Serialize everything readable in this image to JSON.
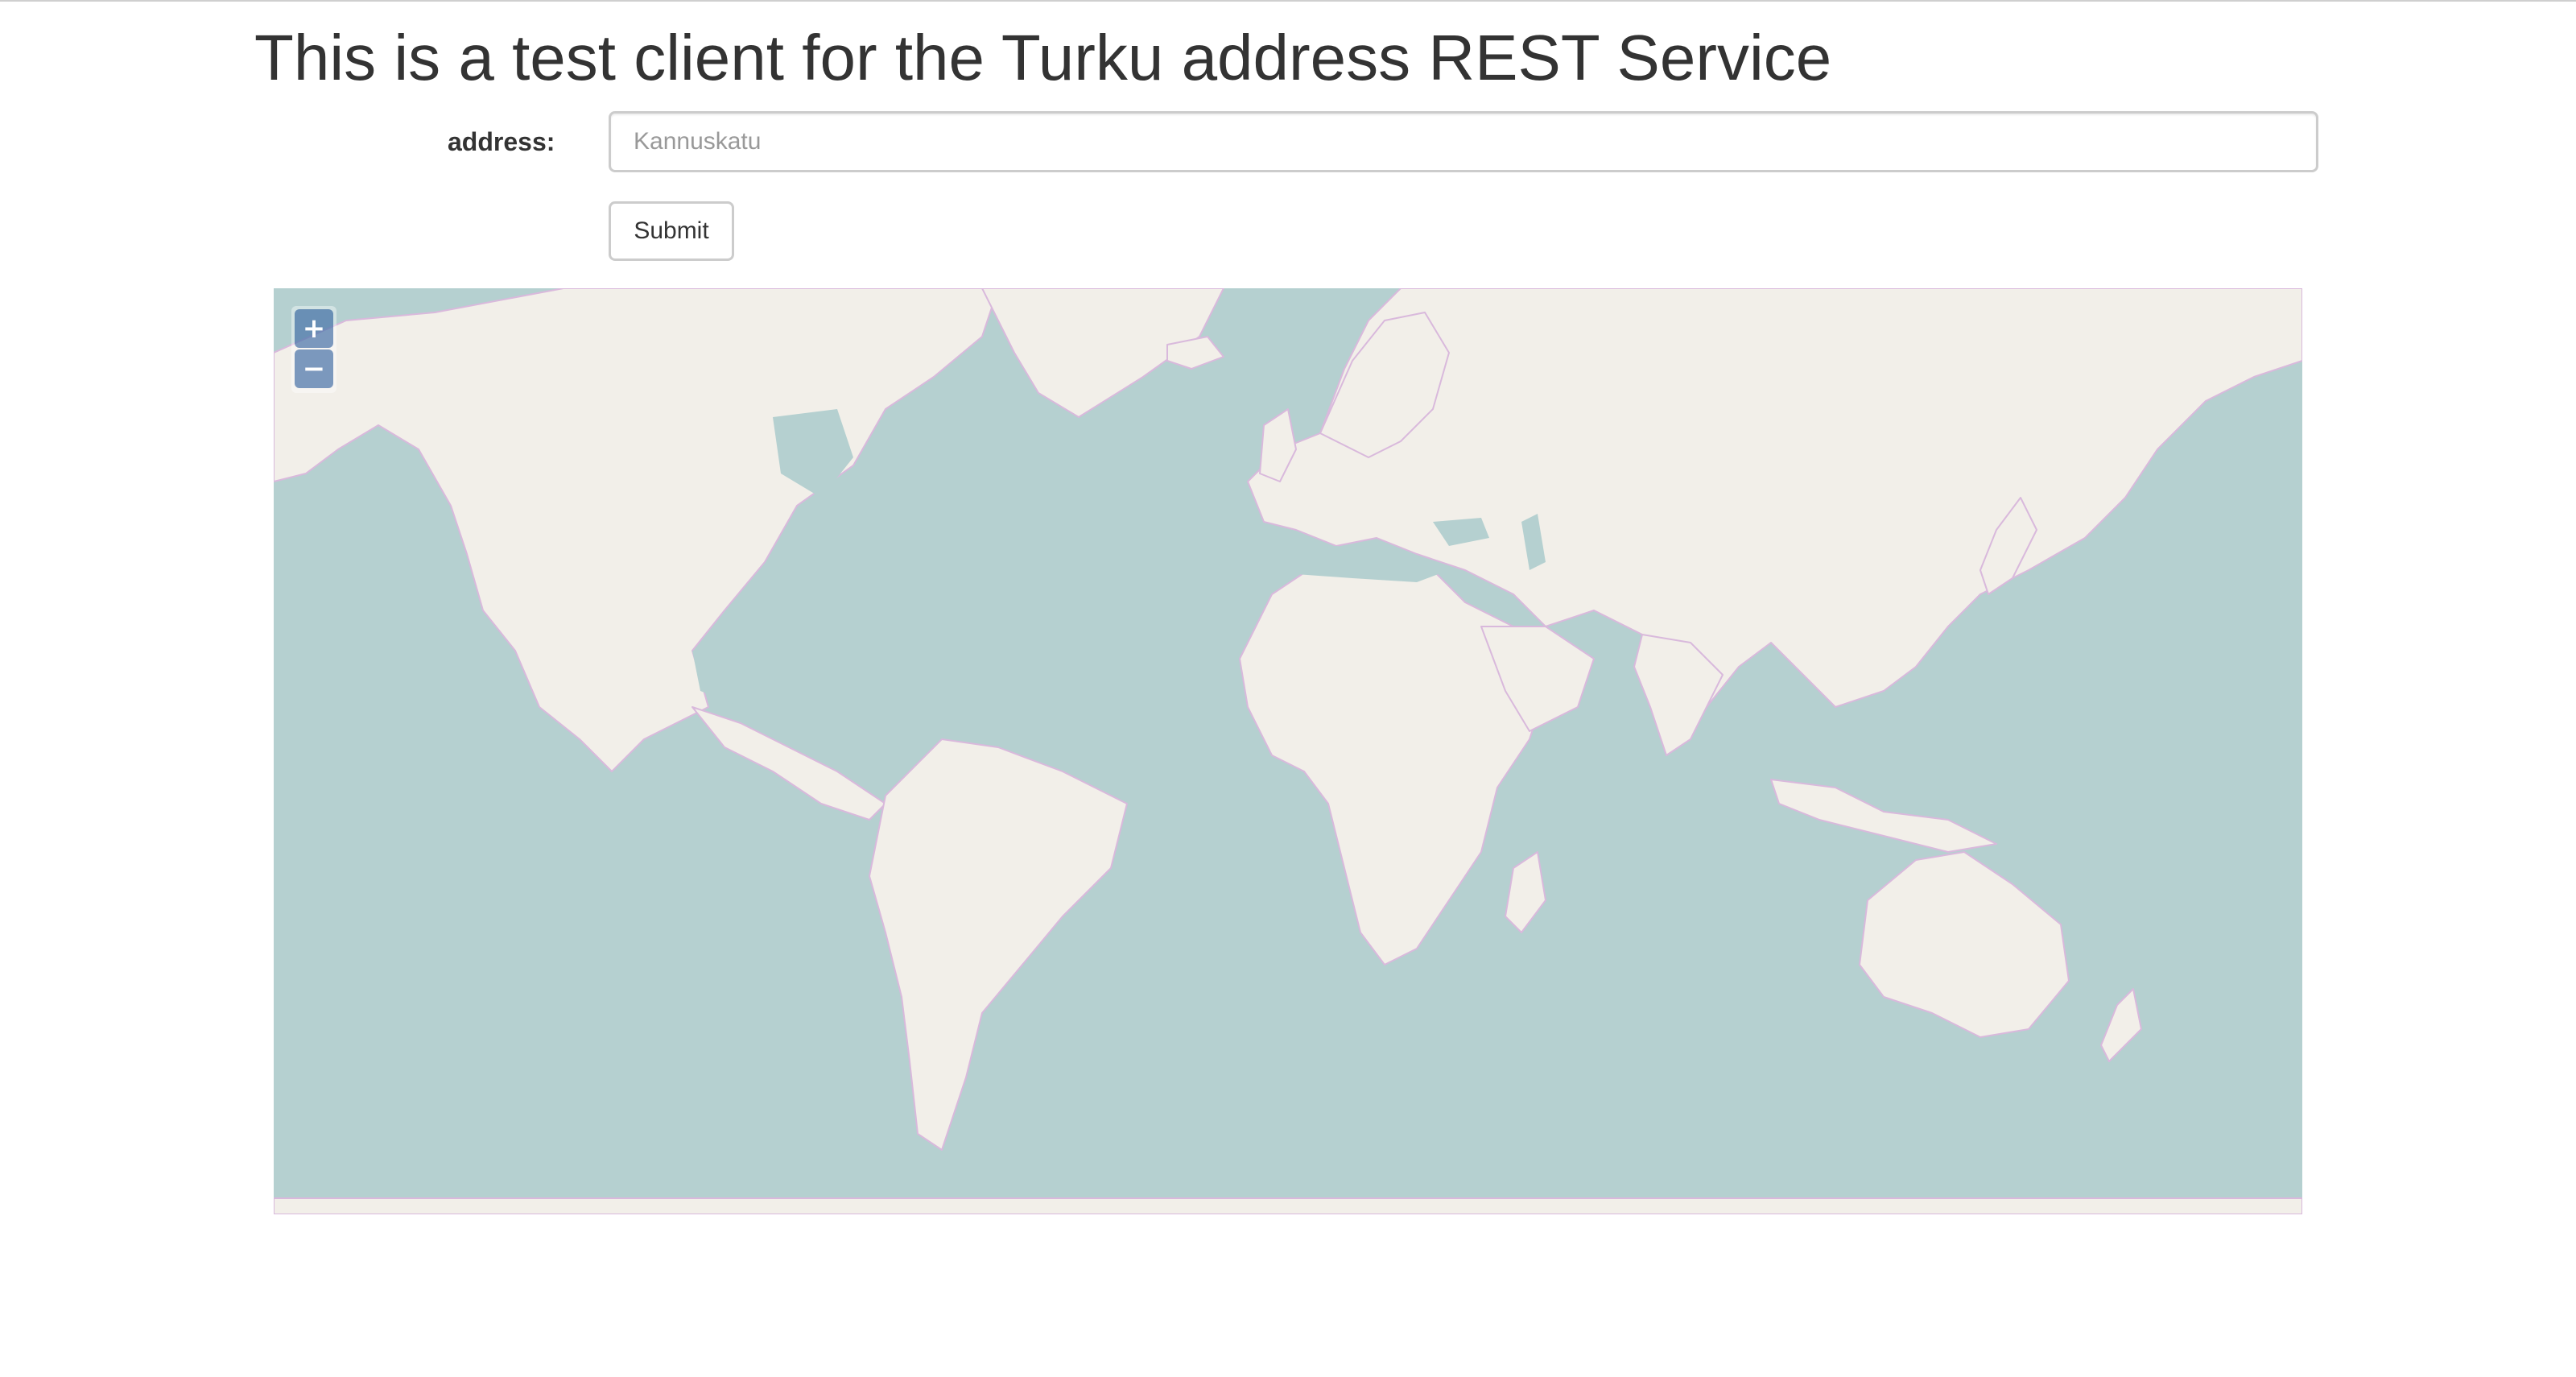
{
  "page": {
    "title": "This is a test client for the Turku address REST Service"
  },
  "form": {
    "address_label": "address:",
    "address_placeholder": "Kannuskatu",
    "address_value": "",
    "submit_label": "Submit"
  },
  "map": {
    "zoom_in_label": "+",
    "zoom_out_label": "−",
    "colors": {
      "water": "#b5d0d0",
      "land": "#f2efe9",
      "border": "#d4a8d8",
      "zoom_button": "#7b98bc"
    }
  }
}
